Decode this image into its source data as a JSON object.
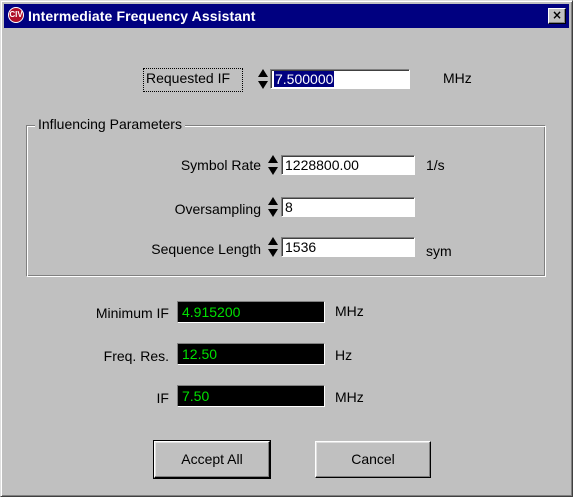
{
  "window": {
    "title": "Intermediate Frequency  Assistant",
    "icon": "app-logo-icon",
    "icon_text": "CIV",
    "close_glyph": "×"
  },
  "requested_if": {
    "label": "Requested IF",
    "value": "7.500000",
    "unit": "MHz"
  },
  "group": {
    "title": "Influencing Parameters",
    "symbol_rate": {
      "label": "Symbol  Rate",
      "value": "1228800.00",
      "unit": "1/s"
    },
    "oversampling": {
      "label": "Oversampling",
      "value": "8",
      "unit": ""
    },
    "sequence_length": {
      "label": "Sequence Length",
      "value": "1536",
      "unit": "sym"
    }
  },
  "results": {
    "minimum_if": {
      "label": "Minimum IF",
      "value": "4.915200",
      "unit": "MHz"
    },
    "freq_res": {
      "label": "Freq. Res.",
      "value": "12.50",
      "unit": "Hz"
    },
    "if": {
      "label": "IF",
      "value": "7.50",
      "unit": "MHz"
    }
  },
  "buttons": {
    "accept_all": "Accept All",
    "cancel": "Cancel"
  },
  "colors": {
    "titlebar": "#000080",
    "readout_bg": "#000000",
    "readout_text": "#00e000",
    "dialog_bg": "#c0c0c0"
  }
}
